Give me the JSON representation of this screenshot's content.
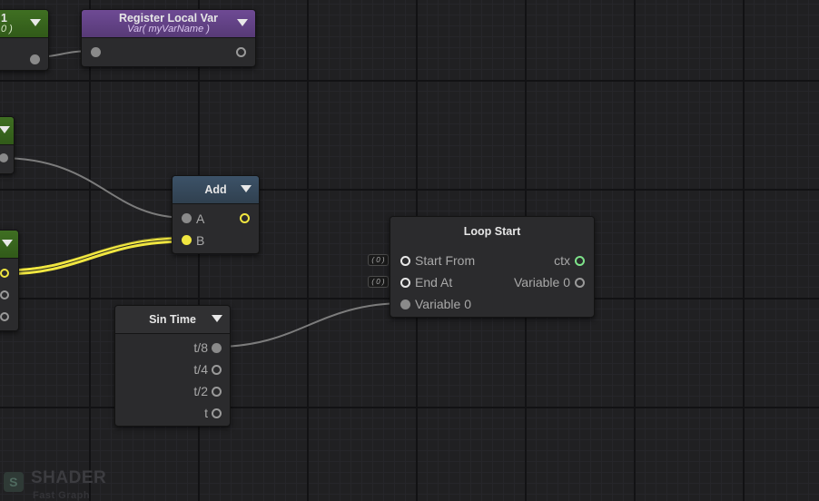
{
  "nodes": {
    "partial_top": {
      "title": "1",
      "subtitle": "0 )"
    },
    "register_local_var": {
      "title": "Register Local Var",
      "subtitle": "Var( myVarName )"
    },
    "add": {
      "title": "Add",
      "inputs": [
        "A",
        "B"
      ]
    },
    "loop_start": {
      "title": "Loop Start",
      "inputs": [
        "Start From",
        "End At",
        "Variable 0"
      ],
      "outputs": [
        "ctx",
        "Variable 0"
      ],
      "constants": [
        "( 0 )",
        "( 0 )"
      ]
    },
    "sin_time": {
      "title": "Sin Time",
      "outputs": [
        "t/8",
        "t/4",
        "t/2",
        "t"
      ]
    }
  },
  "watermark": {
    "logo_glyph": "S",
    "name": "SHADER",
    "sub": "Fast Graph"
  },
  "colors": {
    "yellow_wire": "#f0e640",
    "green_port": "#7ee38a",
    "purple_header": "#6e4a94",
    "blue_header": "#3c5268"
  }
}
